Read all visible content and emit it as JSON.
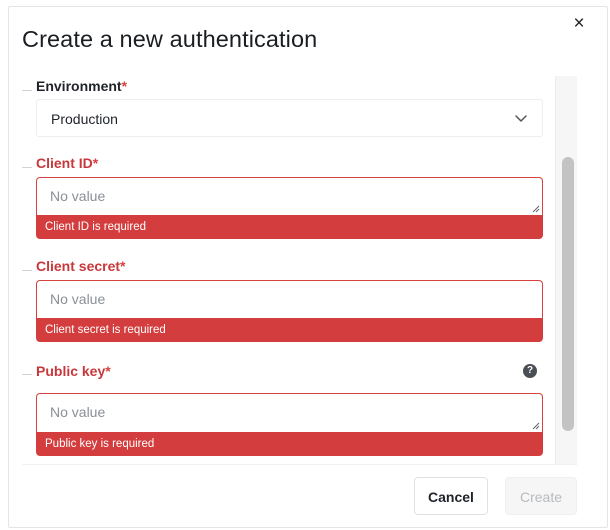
{
  "dialog": {
    "title": "Create a new authentication",
    "close_glyph": "×"
  },
  "fields": {
    "environment": {
      "label": "Environment",
      "required_mark": "*",
      "value": "Production"
    },
    "client_id": {
      "label": "Client ID",
      "required_mark": "*",
      "placeholder": "No value",
      "error": "Client ID is required"
    },
    "client_secret": {
      "label": "Client secret",
      "required_mark": "*",
      "placeholder": "No value",
      "error": "Client secret is required"
    },
    "public_key": {
      "label": "Public key",
      "required_mark": "*",
      "placeholder": "No value",
      "error": "Public key is required",
      "help_glyph": "?"
    }
  },
  "footer": {
    "cancel_label": "Cancel",
    "create_label": "Create"
  },
  "icons": {
    "close": "close-icon",
    "select_chevron": "chevron-down-icon",
    "help": "question-circle-icon",
    "resize": "resize-grip-icon"
  },
  "colors": {
    "error": "#d43d3d",
    "error_text": "#c8383b",
    "disabled_text": "#b7bbc0"
  }
}
